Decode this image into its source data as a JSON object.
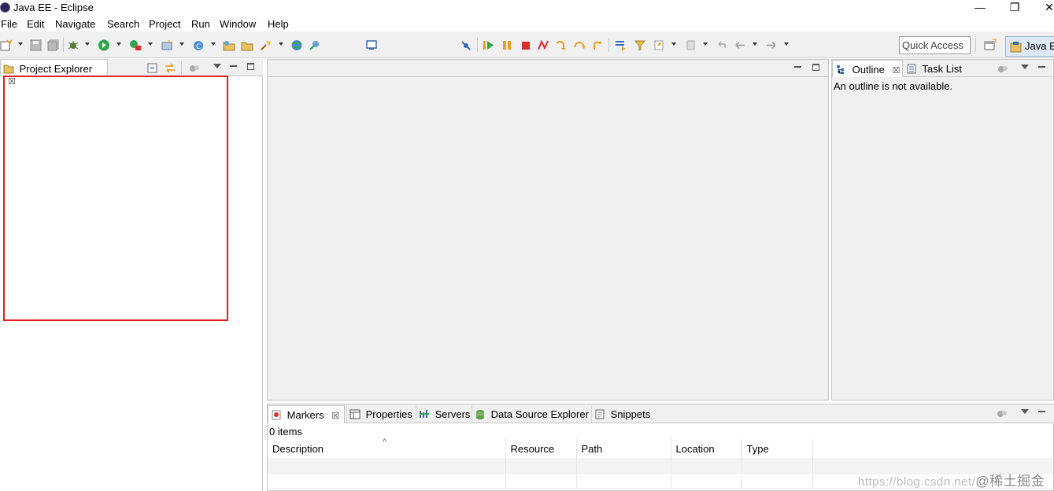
{
  "window": {
    "title": "Java EE - Eclipse",
    "minimize_glyph": "—",
    "restore_glyph": "❐",
    "close_glyph": "✕"
  },
  "menu": [
    "File",
    "Edit",
    "Navigate",
    "Search",
    "Project",
    "Run",
    "Window",
    "Help"
  ],
  "toolbar": {
    "quick_access_placeholder": "Quick Access",
    "perspective_label": "Java E"
  },
  "left_view": {
    "tab_label": "Project Explorer",
    "close_glyph": "☒",
    "highlight_color": "#e02020"
  },
  "outline_view": {
    "tabs": [
      "Outline",
      "Task List"
    ],
    "message": "An outline is not available.",
    "close_glyph": "☒"
  },
  "bottom_view": {
    "tabs": [
      "Markers",
      "Properties",
      "Servers",
      "Data Source Explorer",
      "Snippets"
    ],
    "close_glyph": "☒",
    "item_count": "0 items",
    "sort_glyph": "^",
    "columns": [
      "Description",
      "Resource",
      "Path",
      "Location",
      "Type"
    ]
  },
  "watermark": {
    "url": "https://blog.csdn.net/",
    "text": "@稀土掘金技术社区"
  },
  "colors": {
    "accent": "#2a7fd4",
    "run_green": "#2ea44f",
    "stop_red": "#d63030",
    "pause_orange": "#e8a020",
    "selection_box": "#e02020"
  }
}
